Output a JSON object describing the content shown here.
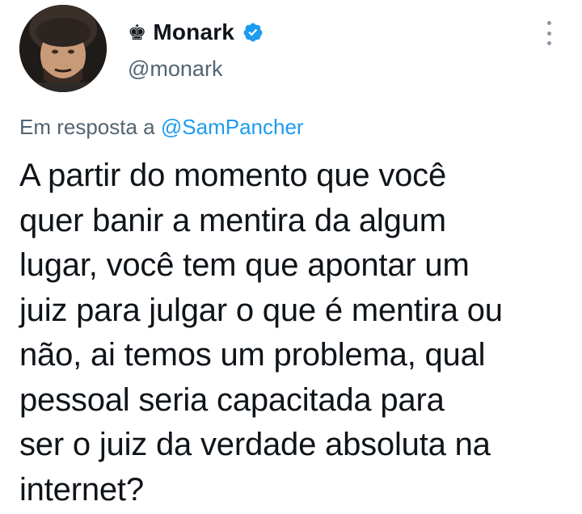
{
  "author": {
    "badge_icon": "crown-icon",
    "badge_glyph": "♚",
    "display_name": "Monark",
    "verified": true,
    "handle": "@monark"
  },
  "reply_context": {
    "prefix": "Em resposta a",
    "handle": "@SamPancher"
  },
  "tweet": {
    "lines": [
      "A partir do momento que você",
      "quer banir a mentira da algum",
      "lugar, você tem que apontar um",
      "juiz para julgar o que é mentira ou",
      "não, ai temos um problema, qual",
      "pessoal seria capacitada para",
      "ser o juiz da verdade absoluta na",
      "internet?"
    ]
  },
  "colors": {
    "link": "#1d9bf0",
    "secondary_text": "#536471",
    "primary_text": "#0f1419",
    "verified_badge": "#1d9bf0"
  }
}
